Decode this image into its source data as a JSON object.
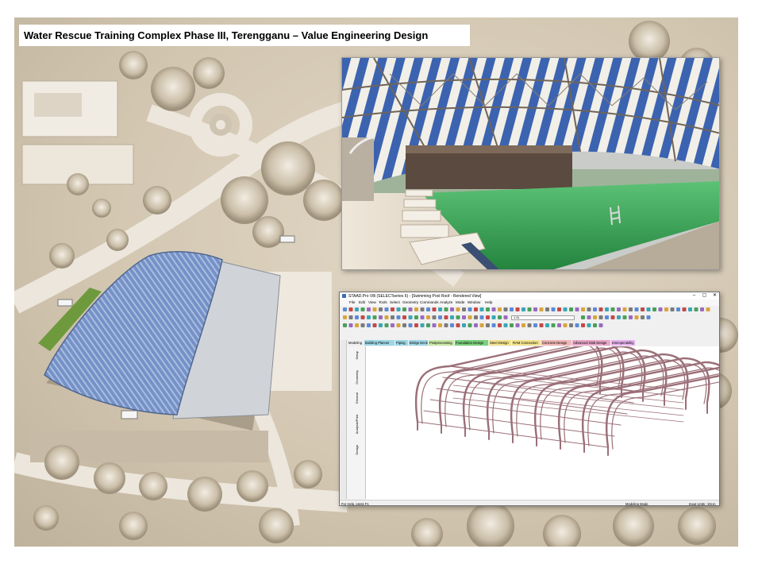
{
  "slide": {
    "title": "Water Rescue Training Complex Phase III, Terengganu – Value Engineering Design"
  },
  "staad": {
    "window_title": "STAAD.Pro V8i (SELECTseries 6) - [Swimming Pool Roof - Rendered View]",
    "minimize_icon": "minimize-icon",
    "restore_icon": "restore-icon",
    "close_icon": "close-icon",
    "menu": [
      "File",
      "Edit",
      "View",
      "Tools",
      "Select",
      "Geometry",
      "Commands",
      "Analyze",
      "Mode",
      "Window",
      "Help"
    ],
    "zoom_value": "1.0L",
    "tabs": [
      {
        "label": "Modeling",
        "color": "#f0f0f0"
      },
      {
        "label": "Building Planner",
        "color": "#9dd7e6"
      },
      {
        "label": "Piping",
        "color": "#9dd7e6"
      },
      {
        "label": "Bridge Deck",
        "color": "#9dd7e6"
      },
      {
        "label": "Postprocessing",
        "color": "#c9e9a6"
      },
      {
        "label": "Foundation Design",
        "color": "#7bd17b"
      },
      {
        "label": "Steel Design",
        "color": "#f3e38e"
      },
      {
        "label": "RAM Connection",
        "color": "#f3e38e"
      },
      {
        "label": "Concrete Design",
        "color": "#f1b6b6"
      },
      {
        "label": "Advanced Slab Design",
        "color": "#e9a7c9"
      },
      {
        "label": "Interoperability",
        "color": "#e7b3ef"
      }
    ],
    "side_tabs": [
      "Setup",
      "Geometry",
      "General",
      "Analysis/Print",
      "Design"
    ],
    "status_left": "For Help, press F1",
    "status_mid": "Modeling Mode",
    "status_right": "Input Units : kN-m"
  },
  "colors": {
    "roof_blue": "#6f8fc4",
    "pool_green": "#2f9a4c",
    "frame_member": "#9b6f78"
  }
}
